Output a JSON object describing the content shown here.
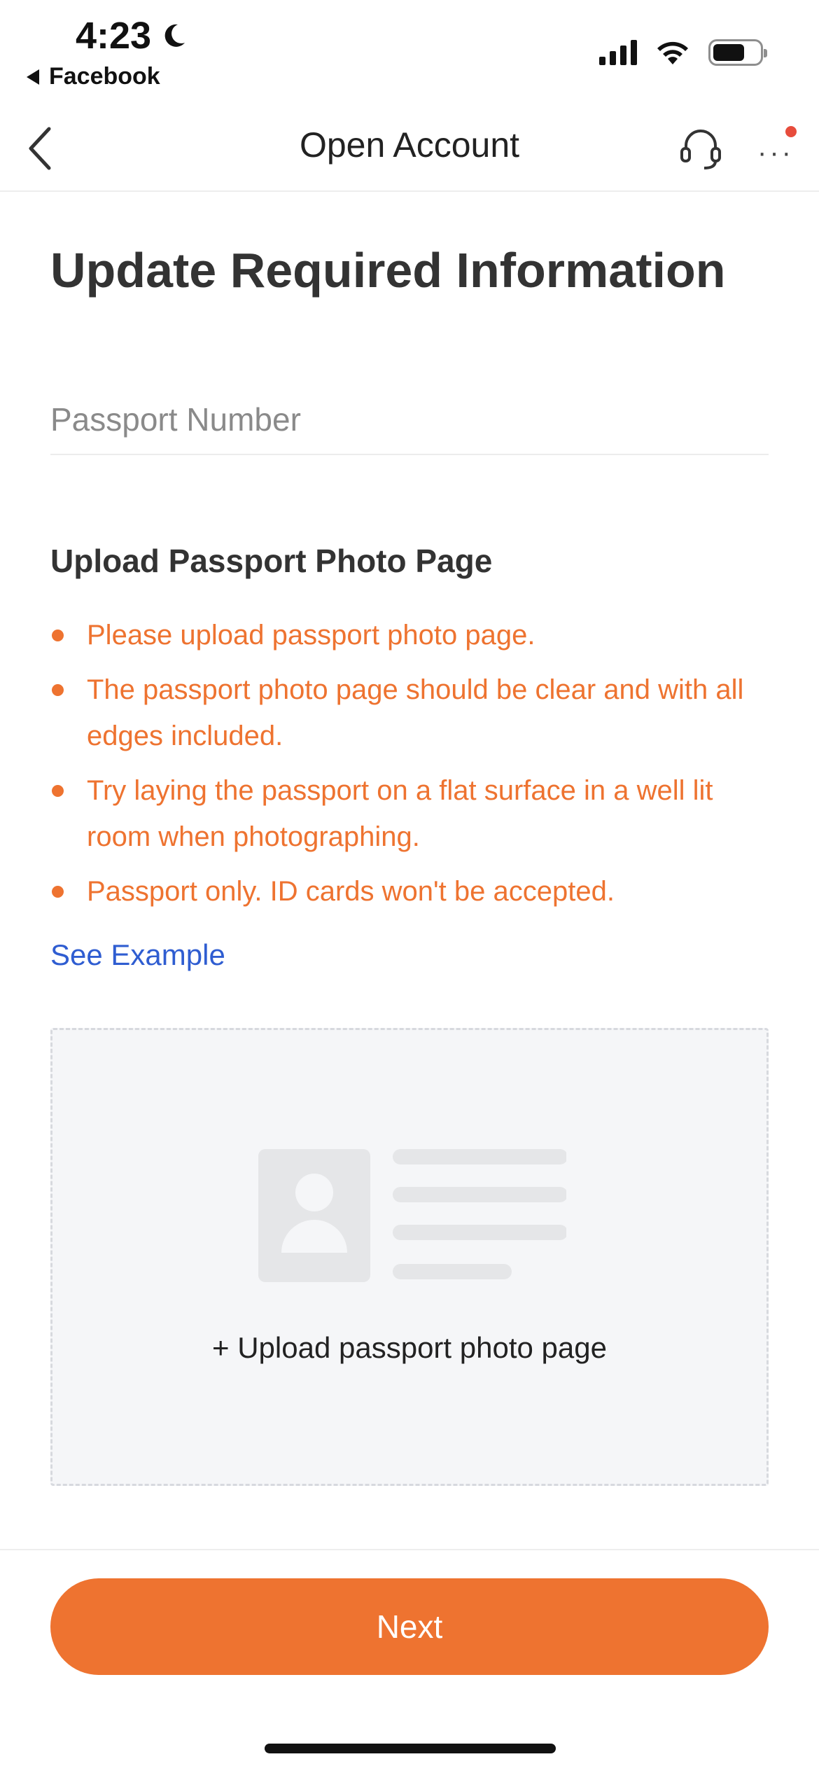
{
  "status_bar": {
    "time": "4:23",
    "back_app": "Facebook",
    "icons": [
      "moon-icon",
      "cellular-signal-icon",
      "wifi-icon",
      "battery-icon"
    ]
  },
  "nav": {
    "title": "Open Account",
    "icons": [
      "chevron-left-icon",
      "headset-icon",
      "more-icon"
    ],
    "notification_color": "#e74c3c"
  },
  "main": {
    "heading": "Update Required Information",
    "passport_number": {
      "placeholder": "Passport Number",
      "value": ""
    },
    "upload_section": {
      "title": "Upload Passport Photo Page",
      "instructions": [
        "Please upload passport photo page.",
        "The passport photo page should be clear and with all edges included.",
        "Try laying the passport on a flat surface in a well lit room when photographing.",
        "Passport only. ID cards won't be accepted."
      ],
      "see_example": "See Example",
      "upload_label": "+ Upload passport photo page"
    }
  },
  "footer": {
    "next_label": "Next"
  },
  "colors": {
    "accent": "#ee7330",
    "link": "#2f5dd1",
    "text": "#333333"
  }
}
